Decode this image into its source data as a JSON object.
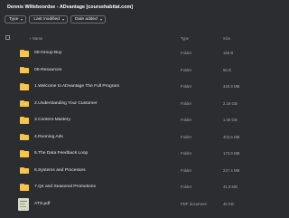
{
  "page": {
    "title": "Dennis Willeboordse - ADvantage [coursehabitat.com]"
  },
  "filters": [
    {
      "label": "Type"
    },
    {
      "label": "Last modified"
    },
    {
      "label": "Date added"
    }
  ],
  "columns": {
    "name": "Name",
    "type": "Type",
    "size": "Size",
    "sort_arrow": "↑"
  },
  "rows": [
    {
      "name": "00-Group Buy",
      "type": "Folder",
      "size": "168 B",
      "icon": "folder-icon"
    },
    {
      "name": "00-Resources",
      "type": "Folder",
      "size": "56 B",
      "icon": "folder-icon"
    },
    {
      "name": "1.Welcome to ADvantage The Full Program",
      "type": "Folder",
      "size": "340.9 MB",
      "icon": "folder-icon"
    },
    {
      "name": "2.Understanding Your Customer",
      "type": "Folder",
      "size": "2.18 GB",
      "icon": "folder-icon"
    },
    {
      "name": "3.Content Mastery",
      "type": "Folder",
      "size": "1.08 GB",
      "icon": "folder-icon"
    },
    {
      "name": "4.Running Ads",
      "type": "Folder",
      "size": "403.6 MB",
      "icon": "folder-icon"
    },
    {
      "name": "5.The Data Feedback Loop",
      "type": "Folder",
      "size": "173.9 MB",
      "icon": "folder-icon"
    },
    {
      "name": "6.Systems and Processes",
      "type": "Folder",
      "size": "227.4 MB",
      "icon": "folder-icon"
    },
    {
      "name": "7.Q4 and Seasonal Promotions",
      "type": "Folder",
      "size": "41.8 MB",
      "icon": "folder-icon"
    },
    {
      "name": "ATS.pdf",
      "type": "PDF document",
      "size": "46 KB",
      "icon": "pdf-thumbnail-icon"
    }
  ]
}
